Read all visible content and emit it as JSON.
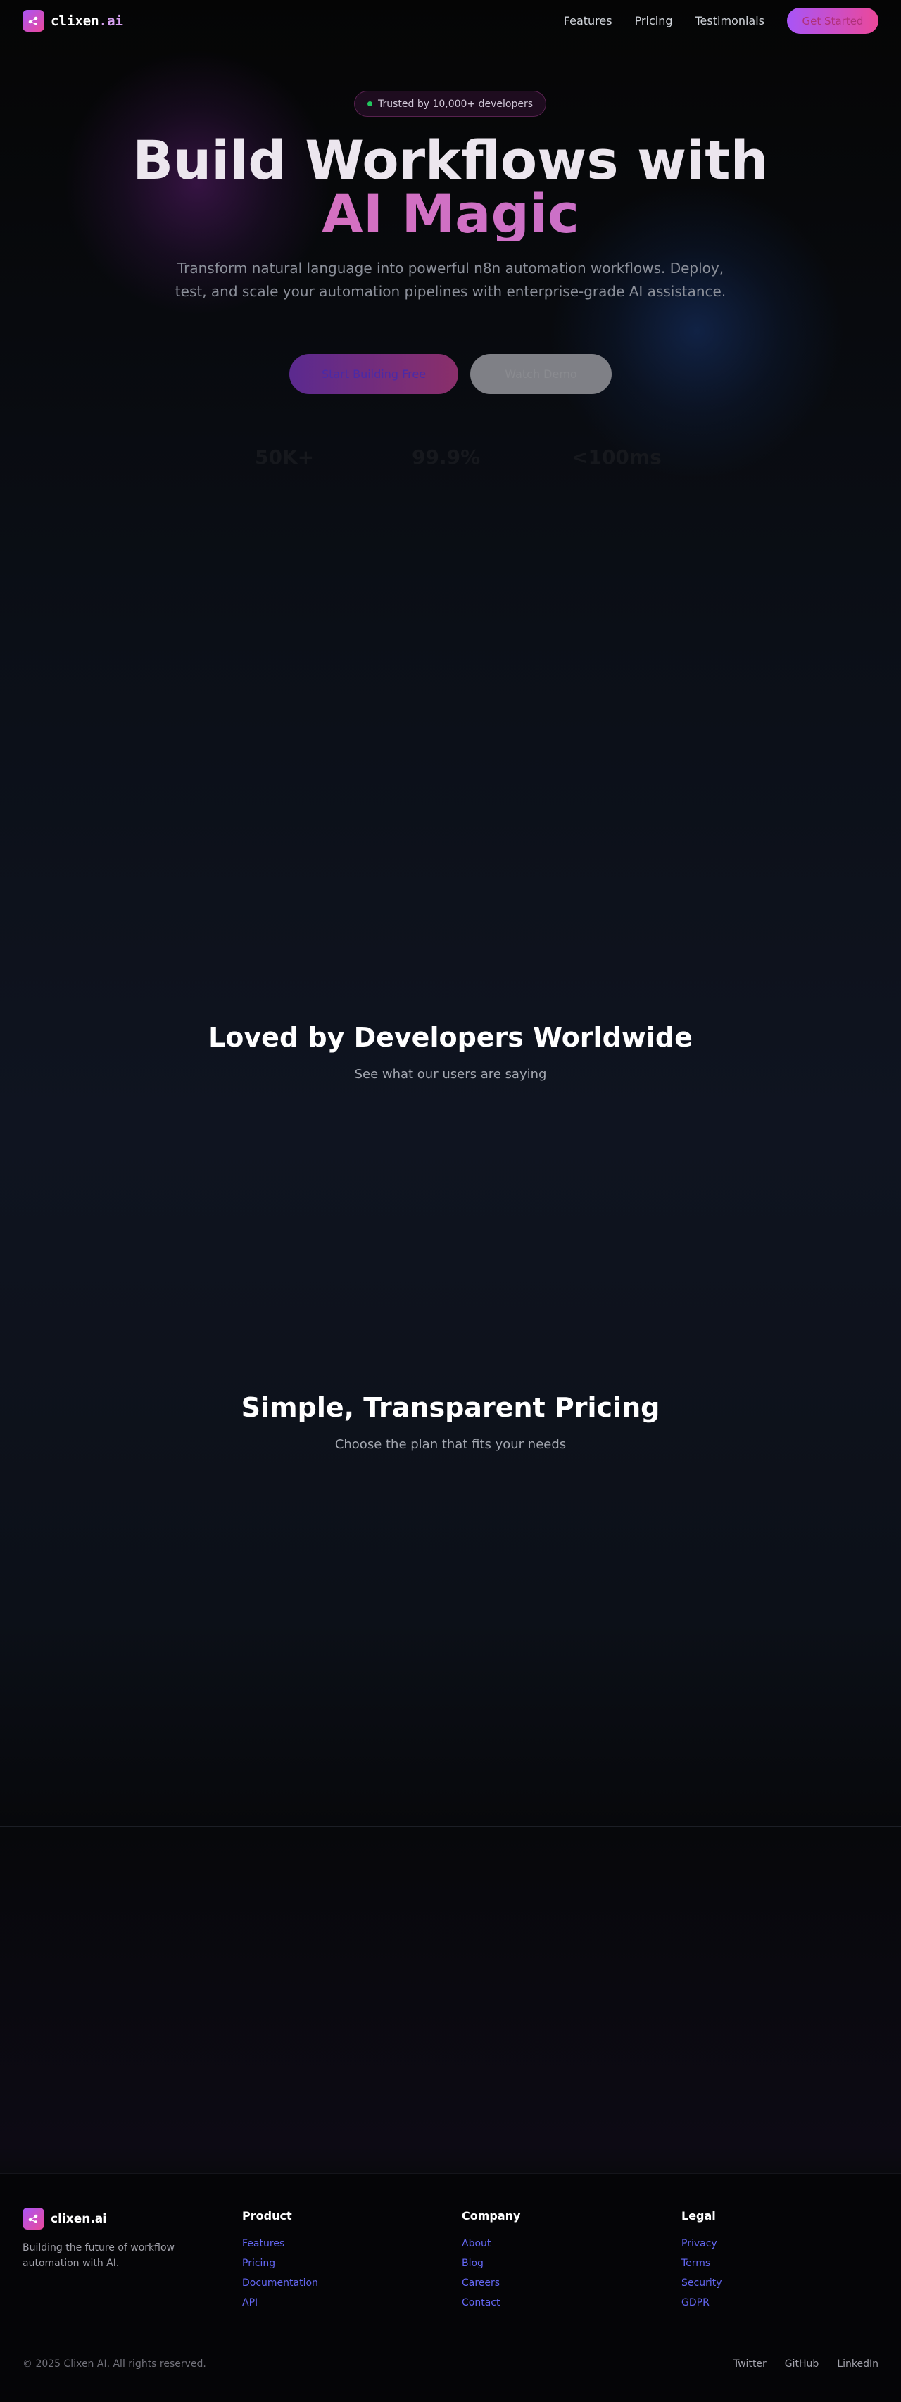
{
  "nav": {
    "brand": "clixen",
    "brand_suffix": ".ai",
    "links": [
      "Features",
      "Pricing",
      "Testimonials"
    ],
    "cta": "Get Started"
  },
  "hero": {
    "badge": "Trusted by 10,000+ developers",
    "title_line1": "Build Workflows with",
    "title_line2": "AI Magic",
    "subtitle": "Transform natural language into powerful n8n automation workflows. Deploy, test, and scale your automation pipelines with enterprise-grade AI assistance.",
    "primary_button": "Start Building Free",
    "secondary_button": "Watch Demo"
  },
  "stats": [
    "50K+",
    "99.9%",
    "<100ms"
  ],
  "testimonials": {
    "title": "Loved by Developers Worldwide",
    "subtitle": "See what our users are saying"
  },
  "pricing": {
    "title": "Simple, Transparent Pricing",
    "subtitle": "Choose the plan that fits your needs"
  },
  "footer": {
    "brand": "clixen.ai",
    "tagline": "Building the future of workflow automation with AI.",
    "columns": [
      {
        "title": "Product",
        "links": [
          "Features",
          "Pricing",
          "Documentation",
          "API"
        ]
      },
      {
        "title": "Company",
        "links": [
          "About",
          "Blog",
          "Careers",
          "Contact"
        ]
      },
      {
        "title": "Legal",
        "links": [
          "Privacy",
          "Terms",
          "Security",
          "GDPR"
        ]
      }
    ],
    "copyright": "© 2025 Clixen AI. All rights reserved.",
    "social": [
      "Twitter",
      "GitHub",
      "LinkedIn"
    ]
  },
  "colors": {
    "accent_from": "#a855f7",
    "accent_to": "#ec4899",
    "link": "#6366f1",
    "status_dot": "#22c55e"
  },
  "icons": [
    "logo-workflow-icon"
  ]
}
